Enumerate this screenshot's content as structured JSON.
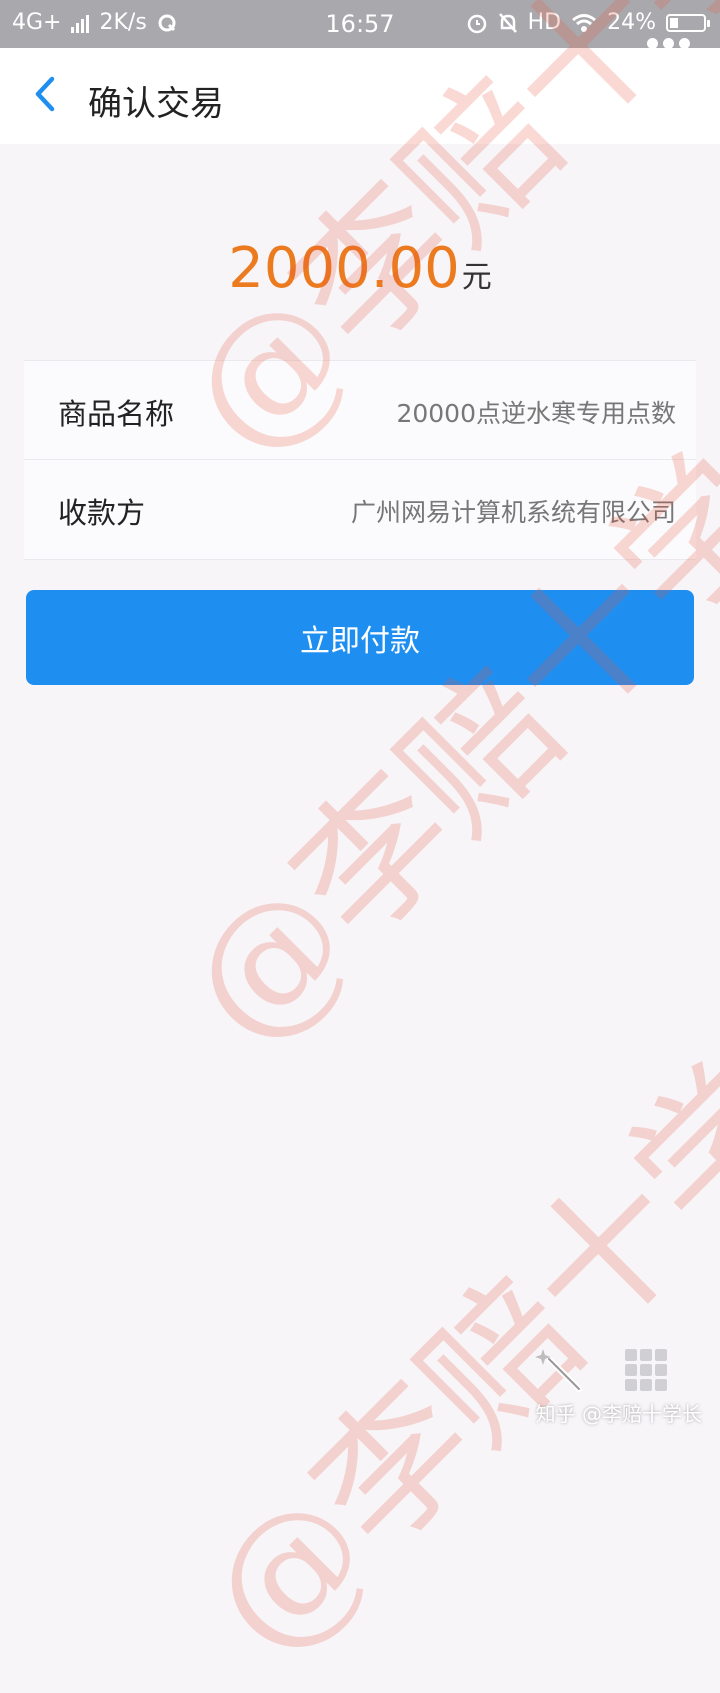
{
  "status_bar": {
    "network": "4G+",
    "speed": "2K/s",
    "time": "16:57",
    "hd": "HD",
    "battery": "24%",
    "battery_level": 0.24
  },
  "nav": {
    "title": "确认交易"
  },
  "payment": {
    "amount": "2000.00",
    "unit": "元",
    "amount_color": "#ec7a1f"
  },
  "details": [
    {
      "label": "商品名称",
      "value": "20000点逆水寒专用点数"
    },
    {
      "label": "收款方",
      "value": "广州网易计算机系统有限公司"
    }
  ],
  "pay_button": {
    "label": "立即付款",
    "color": "#1e8ff1"
  },
  "watermark": {
    "text": "@李赔十学长"
  },
  "credit": {
    "text": "知乎 @李赔十学长"
  }
}
